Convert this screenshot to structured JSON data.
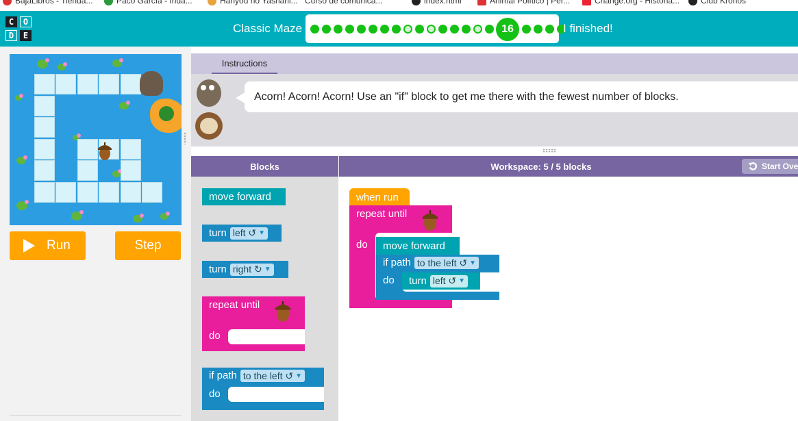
{
  "bookmarks": [
    "BajaLibros - Tienda...",
    "Paco García - Inda...",
    "Hanyou no Yashahi...",
    "Curso de comunica...",
    "index.html",
    "Animal Político | Per...",
    "Change.org - Historia...",
    "Club Kronos"
  ],
  "logo": {
    "letters": [
      "C",
      "O",
      "D",
      "E"
    ]
  },
  "header": {
    "title": "Classic Maze",
    "current_level": "16",
    "finished_label": "I finished!",
    "progress": [
      "done",
      "done",
      "done",
      "done",
      "done",
      "done",
      "done",
      "done",
      "hollow",
      "done",
      "hollow",
      "done",
      "done",
      "done",
      "hollow",
      "done",
      "current",
      "done",
      "done",
      "done",
      "done"
    ]
  },
  "controls": {
    "run_label": "Run",
    "step_label": "Step"
  },
  "instructions": {
    "tab_label": "Instructions",
    "text": "Acorn! Acorn! Acorn! Use an \"if\" block to get me there with the fewest number of blocks."
  },
  "toolbox": {
    "header": "Blocks",
    "move_forward": "move forward",
    "turn_left": {
      "label": "turn",
      "value": "left ↺"
    },
    "turn_right": {
      "label": "turn",
      "value": "right ↻"
    },
    "repeat_until": "repeat until",
    "do_label": "do",
    "if_path": {
      "label": "if path",
      "value": "to the left ↺"
    }
  },
  "workspace": {
    "header": "Workspace: 5 / 5 blocks",
    "start_over": "Start Over",
    "when_run": "when run",
    "repeat_until": "repeat until",
    "do_label": "do",
    "move_forward": "move forward",
    "if_path": {
      "label": "if path",
      "value": "to the left ↺"
    },
    "turn": {
      "label": "turn",
      "value": "left ↺"
    }
  },
  "colors": {
    "header": "#00adbc",
    "purple": "#7665a0",
    "teal_block": "#00a4b0",
    "blue_block": "#1a8ac2",
    "pink_block": "#e91e9c",
    "orange": "#ffa400",
    "progress_green": "#14c114"
  }
}
